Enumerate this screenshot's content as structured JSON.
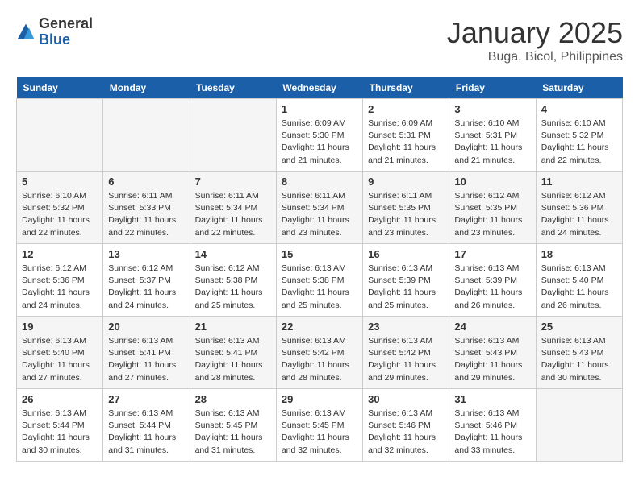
{
  "header": {
    "logo_general": "General",
    "logo_blue": "Blue",
    "month_title": "January 2025",
    "location": "Buga, Bicol, Philippines"
  },
  "weekdays": [
    "Sunday",
    "Monday",
    "Tuesday",
    "Wednesday",
    "Thursday",
    "Friday",
    "Saturday"
  ],
  "weeks": [
    [
      {
        "day": "",
        "info": ""
      },
      {
        "day": "",
        "info": ""
      },
      {
        "day": "",
        "info": ""
      },
      {
        "day": "1",
        "info": "Sunrise: 6:09 AM\nSunset: 5:30 PM\nDaylight: 11 hours\nand 21 minutes."
      },
      {
        "day": "2",
        "info": "Sunrise: 6:09 AM\nSunset: 5:31 PM\nDaylight: 11 hours\nand 21 minutes."
      },
      {
        "day": "3",
        "info": "Sunrise: 6:10 AM\nSunset: 5:31 PM\nDaylight: 11 hours\nand 21 minutes."
      },
      {
        "day": "4",
        "info": "Sunrise: 6:10 AM\nSunset: 5:32 PM\nDaylight: 11 hours\nand 22 minutes."
      }
    ],
    [
      {
        "day": "5",
        "info": "Sunrise: 6:10 AM\nSunset: 5:32 PM\nDaylight: 11 hours\nand 22 minutes."
      },
      {
        "day": "6",
        "info": "Sunrise: 6:11 AM\nSunset: 5:33 PM\nDaylight: 11 hours\nand 22 minutes."
      },
      {
        "day": "7",
        "info": "Sunrise: 6:11 AM\nSunset: 5:34 PM\nDaylight: 11 hours\nand 22 minutes."
      },
      {
        "day": "8",
        "info": "Sunrise: 6:11 AM\nSunset: 5:34 PM\nDaylight: 11 hours\nand 23 minutes."
      },
      {
        "day": "9",
        "info": "Sunrise: 6:11 AM\nSunset: 5:35 PM\nDaylight: 11 hours\nand 23 minutes."
      },
      {
        "day": "10",
        "info": "Sunrise: 6:12 AM\nSunset: 5:35 PM\nDaylight: 11 hours\nand 23 minutes."
      },
      {
        "day": "11",
        "info": "Sunrise: 6:12 AM\nSunset: 5:36 PM\nDaylight: 11 hours\nand 24 minutes."
      }
    ],
    [
      {
        "day": "12",
        "info": "Sunrise: 6:12 AM\nSunset: 5:36 PM\nDaylight: 11 hours\nand 24 minutes."
      },
      {
        "day": "13",
        "info": "Sunrise: 6:12 AM\nSunset: 5:37 PM\nDaylight: 11 hours\nand 24 minutes."
      },
      {
        "day": "14",
        "info": "Sunrise: 6:12 AM\nSunset: 5:38 PM\nDaylight: 11 hours\nand 25 minutes."
      },
      {
        "day": "15",
        "info": "Sunrise: 6:13 AM\nSunset: 5:38 PM\nDaylight: 11 hours\nand 25 minutes."
      },
      {
        "day": "16",
        "info": "Sunrise: 6:13 AM\nSunset: 5:39 PM\nDaylight: 11 hours\nand 25 minutes."
      },
      {
        "day": "17",
        "info": "Sunrise: 6:13 AM\nSunset: 5:39 PM\nDaylight: 11 hours\nand 26 minutes."
      },
      {
        "day": "18",
        "info": "Sunrise: 6:13 AM\nSunset: 5:40 PM\nDaylight: 11 hours\nand 26 minutes."
      }
    ],
    [
      {
        "day": "19",
        "info": "Sunrise: 6:13 AM\nSunset: 5:40 PM\nDaylight: 11 hours\nand 27 minutes."
      },
      {
        "day": "20",
        "info": "Sunrise: 6:13 AM\nSunset: 5:41 PM\nDaylight: 11 hours\nand 27 minutes."
      },
      {
        "day": "21",
        "info": "Sunrise: 6:13 AM\nSunset: 5:41 PM\nDaylight: 11 hours\nand 28 minutes."
      },
      {
        "day": "22",
        "info": "Sunrise: 6:13 AM\nSunset: 5:42 PM\nDaylight: 11 hours\nand 28 minutes."
      },
      {
        "day": "23",
        "info": "Sunrise: 6:13 AM\nSunset: 5:42 PM\nDaylight: 11 hours\nand 29 minutes."
      },
      {
        "day": "24",
        "info": "Sunrise: 6:13 AM\nSunset: 5:43 PM\nDaylight: 11 hours\nand 29 minutes."
      },
      {
        "day": "25",
        "info": "Sunrise: 6:13 AM\nSunset: 5:43 PM\nDaylight: 11 hours\nand 30 minutes."
      }
    ],
    [
      {
        "day": "26",
        "info": "Sunrise: 6:13 AM\nSunset: 5:44 PM\nDaylight: 11 hours\nand 30 minutes."
      },
      {
        "day": "27",
        "info": "Sunrise: 6:13 AM\nSunset: 5:44 PM\nDaylight: 11 hours\nand 31 minutes."
      },
      {
        "day": "28",
        "info": "Sunrise: 6:13 AM\nSunset: 5:45 PM\nDaylight: 11 hours\nand 31 minutes."
      },
      {
        "day": "29",
        "info": "Sunrise: 6:13 AM\nSunset: 5:45 PM\nDaylight: 11 hours\nand 32 minutes."
      },
      {
        "day": "30",
        "info": "Sunrise: 6:13 AM\nSunset: 5:46 PM\nDaylight: 11 hours\nand 32 minutes."
      },
      {
        "day": "31",
        "info": "Sunrise: 6:13 AM\nSunset: 5:46 PM\nDaylight: 11 hours\nand 33 minutes."
      },
      {
        "day": "",
        "info": ""
      }
    ]
  ]
}
